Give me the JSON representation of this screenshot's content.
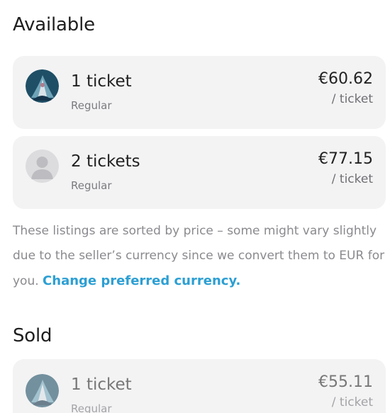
{
  "available": {
    "title": "Available",
    "listings": [
      {
        "quantity": "1 ticket",
        "type": "Regular",
        "price": "€60.62",
        "per_unit": "/ ticket",
        "avatar": "user-photo-avatar"
      },
      {
        "quantity": "2 tickets",
        "type": "Regular",
        "price": "€77.15",
        "per_unit": "/ ticket",
        "avatar": "default-user-avatar"
      }
    ]
  },
  "note": {
    "text": "These listings are sorted by price – some might vary slightly due to the seller’s currency since we convert them to EUR for you.",
    "link": "Change preferred currency."
  },
  "sold": {
    "title": "Sold",
    "listings": [
      {
        "quantity": "1 ticket",
        "type": "Regular",
        "price": "€55.11",
        "per_unit": "/ ticket",
        "avatar": "user-photo-avatar"
      }
    ]
  },
  "colors": {
    "card_bg": "#f3f3f4",
    "link": "#2c9fd3",
    "muted_text": "#8a8a8f"
  }
}
